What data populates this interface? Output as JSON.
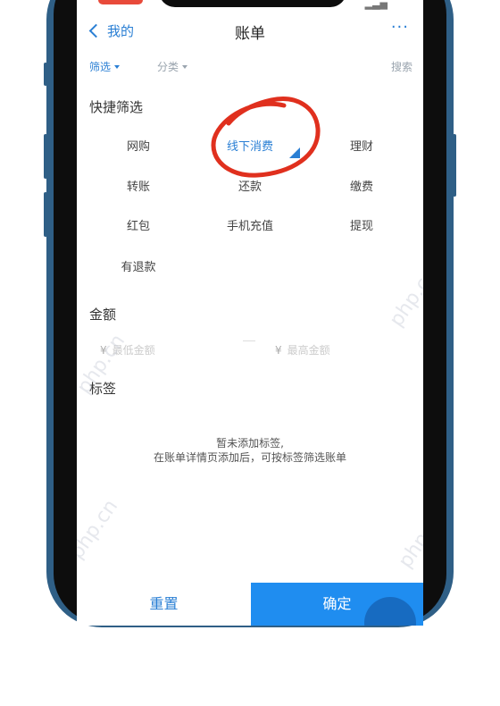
{
  "nav": {
    "back_label": "我的",
    "title": "账单",
    "more_label": "···"
  },
  "filterbar": {
    "filter_label": "筛选",
    "category_label": "分类",
    "search_label": "搜索"
  },
  "quick_filter": {
    "title": "快捷筛选",
    "options": [
      "网购",
      "线下消费",
      "理财",
      "转账",
      "还款",
      "缴费",
      "红包",
      "手机充值",
      "提现",
      "有退款"
    ],
    "selected": "线下消费"
  },
  "amount": {
    "title": "金额",
    "currency_symbol": "¥",
    "min_placeholder": "最低金额",
    "max_placeholder": "最高金额"
  },
  "tags": {
    "title": "标签",
    "empty_line1": "暂未添加标签,",
    "empty_line2": "在账单详情页添加后，可按标签筛选账单"
  },
  "actions": {
    "reset_label": "重置",
    "confirm_label": "确定"
  },
  "watermark": "php.cn",
  "colors": {
    "accent": "#2a7fd4",
    "confirm_bg": "#1f8df0",
    "frame": "#2f5f86",
    "annotation": "#e0301e"
  }
}
